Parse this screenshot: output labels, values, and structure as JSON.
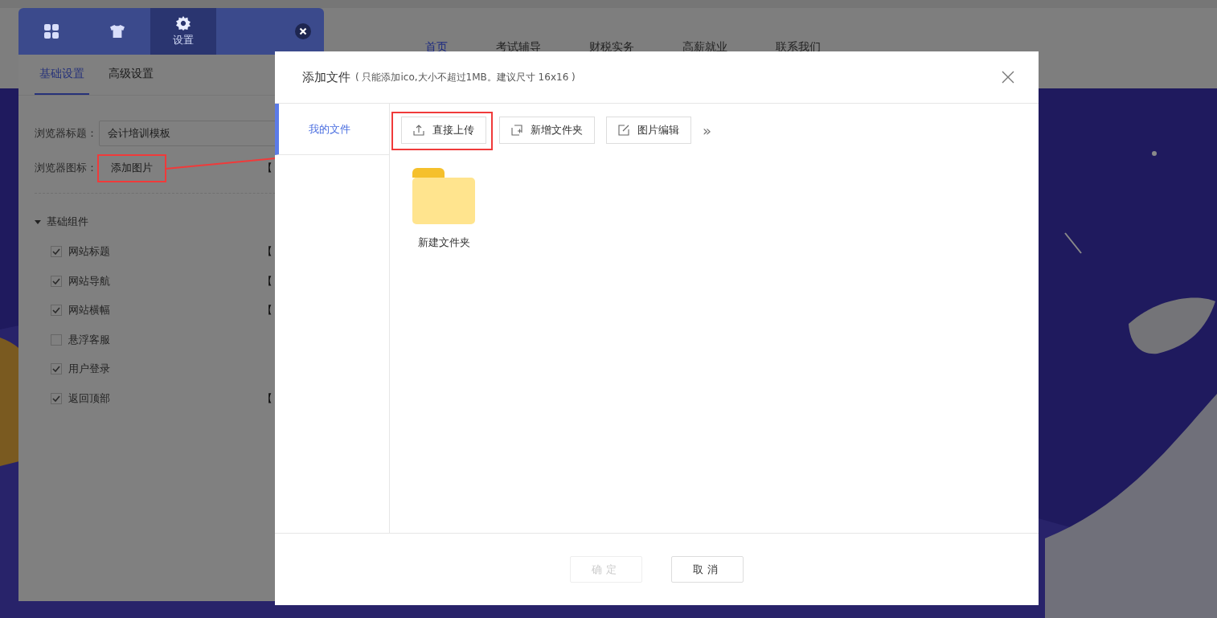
{
  "website": {
    "nav": [
      {
        "label": "首页",
        "selected": true
      },
      {
        "label": "考试辅导",
        "selected": false
      },
      {
        "label": "财税实务",
        "selected": false
      },
      {
        "label": "高薪就业",
        "selected": false
      },
      {
        "label": "联系我们",
        "selected": false
      }
    ]
  },
  "editor": {
    "tabs": [
      {
        "kind": "grid",
        "selected": false
      },
      {
        "kind": "shirt",
        "selected": false
      },
      {
        "kind": "gear",
        "label": "设置",
        "selected": true
      }
    ],
    "subtabs": [
      {
        "label": "基础设置",
        "selected": true
      },
      {
        "label": "高级设置",
        "selected": false
      }
    ],
    "fields": [
      {
        "kind": "input",
        "label": "浏览器标题：",
        "value": "会计培训模板",
        "highlighted": false
      },
      {
        "kind": "button",
        "label": "浏览器图标：",
        "value": "添加图片",
        "highlighted": true,
        "suffix": "【"
      }
    ],
    "group": {
      "label": "基础组件",
      "expanded": true,
      "items": [
        {
          "label": "网站标题",
          "checked": true,
          "suffix": "【"
        },
        {
          "label": "网站导航",
          "checked": true,
          "suffix": "【"
        },
        {
          "label": "网站横幅",
          "checked": true,
          "suffix": "【"
        },
        {
          "label": "悬浮客服",
          "checked": false
        },
        {
          "label": "用户登录",
          "checked": true
        },
        {
          "label": "返回顶部",
          "checked": true,
          "suffix": "【"
        }
      ]
    }
  },
  "dialog": {
    "title": "添加文件",
    "hint": "( 只能添加ico,大小不超过1MB。建议尺寸 16x16 )",
    "sidebar": [
      {
        "label": "我的文件",
        "selected": true
      }
    ],
    "toolbar": [
      {
        "kind": "upload",
        "label": "直接上传",
        "highlighted": true
      },
      {
        "kind": "new-folder",
        "label": "新增文件夹",
        "highlighted": false
      },
      {
        "kind": "edit",
        "label": "图片编辑",
        "highlighted": false
      }
    ],
    "more": "»",
    "files": [
      {
        "kind": "folder",
        "name": "新建文件夹"
      }
    ],
    "footer": [
      {
        "label": "确定",
        "disabled": true
      },
      {
        "label": "取消",
        "disabled": false
      }
    ]
  }
}
